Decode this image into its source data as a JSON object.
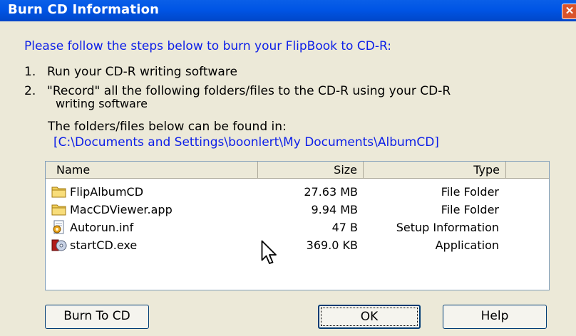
{
  "window": {
    "title": "Burn CD Information",
    "close_label": "✕"
  },
  "instructions": {
    "intro": "Please follow the steps below to burn your FlipBook to CD-R:",
    "step1_num": "1.",
    "step1": "Run your CD-R writing software",
    "step2_num": "2.",
    "step2_line1": "\"Record\" all the following folders/files to the CD-R using your CD-R",
    "step2_line2": "writing software",
    "location_label": "The folders/files below can be found in:",
    "location_path": "[C:\\Documents and Settings\\boonlert\\My Documents\\AlbumCD]"
  },
  "files": {
    "columns": [
      "Name",
      "Size",
      "Type"
    ],
    "rows": [
      {
        "name": "FlipAlbumCD",
        "size": "27.63 MB",
        "type": "File Folder",
        "icon": "folder-icon"
      },
      {
        "name": "MacCDViewer.app",
        "size": "9.94 MB",
        "type": "File Folder",
        "icon": "folder-icon"
      },
      {
        "name": "Autorun.inf",
        "size": "47 B",
        "type": "Setup Information",
        "icon": "setup-file-icon"
      },
      {
        "name": "startCD.exe",
        "size": "369.0 KB",
        "type": "Application",
        "icon": "application-icon"
      }
    ]
  },
  "buttons": {
    "burn": "Burn To CD",
    "ok": "OK",
    "help": "Help"
  },
  "colors": {
    "titlebar": "#0055e5",
    "link_text": "#0c1ee8",
    "window_bg": "#ece9d8"
  }
}
